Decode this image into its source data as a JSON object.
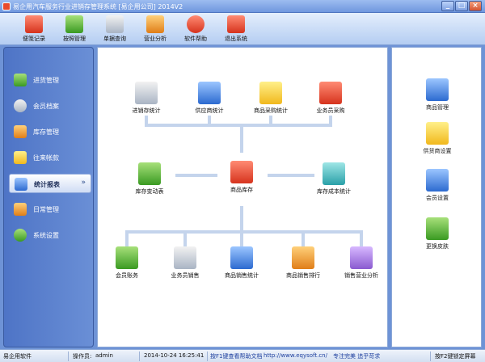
{
  "window": {
    "title": "易企用汽车服务行业进销存管理系统 [易企用公司] 2014V2",
    "controls": {
      "minimize": "_",
      "maximize": "□",
      "close": "×"
    }
  },
  "toolbar": {
    "items": [
      {
        "label": "便笺记录",
        "icon": "notepad-icon"
      },
      {
        "label": "按照管理",
        "icon": "users-icon"
      },
      {
        "label": "单据查询",
        "icon": "magnifier-icon"
      },
      {
        "label": "营业分析",
        "icon": "bar-chart-icon"
      },
      {
        "label": "软件帮助",
        "icon": "help-icon"
      },
      {
        "label": "退出系统",
        "icon": "power-icon"
      }
    ]
  },
  "sidebar": {
    "items": [
      {
        "label": "进货管理",
        "icon": "plus-icon"
      },
      {
        "label": "会员档案",
        "icon": "members-icon"
      },
      {
        "label": "库存管理",
        "icon": "star-icon"
      },
      {
        "label": "往来帐款",
        "icon": "dollar-icon"
      },
      {
        "label": "统计报表",
        "icon": "stats-icon",
        "active": true,
        "chevron": "»"
      },
      {
        "label": "日常管理",
        "icon": "folder-icon"
      },
      {
        "label": "系统设置",
        "icon": "gear-icon"
      }
    ]
  },
  "main": {
    "top_nodes": [
      {
        "label": "进销存统计",
        "icon": "report-chart-icon"
      },
      {
        "label": "供应商统计",
        "icon": "supplier-book-icon"
      },
      {
        "label": "商品采购统计",
        "icon": "purchase-chart-icon"
      },
      {
        "label": "业务员采购",
        "icon": "salesman-icon"
      }
    ],
    "middle_nodes": [
      {
        "label": "库存变动表",
        "icon": "boxes-icon"
      },
      {
        "label": "商品库存",
        "icon": "house-icon"
      },
      {
        "label": "库存成本统计",
        "icon": "cost-chart-icon"
      }
    ],
    "bottom_nodes": [
      {
        "label": "会员账务",
        "icon": "member-account-icon"
      },
      {
        "label": "业务员销售",
        "icon": "salesman-sales-icon"
      },
      {
        "label": "商品销售统计",
        "icon": "sales-stat-icon"
      },
      {
        "label": "商品销售排行",
        "icon": "sales-rank-icon"
      },
      {
        "label": "销售营业分析",
        "icon": "sales-analysis-icon"
      }
    ]
  },
  "rightpanel": {
    "items": [
      {
        "label": "商品管理",
        "icon": "product-manage-icon"
      },
      {
        "label": "供货商设置",
        "icon": "supplier-settings-icon"
      },
      {
        "label": "会员设置",
        "icon": "member-settings-icon"
      },
      {
        "label": "更换皮肤",
        "icon": "skin-icon"
      }
    ]
  },
  "statusbar": {
    "app": "易企用软件",
    "operator_label": "操作员:",
    "operator": "admin",
    "datetime": "2014-10-24 16:25:41",
    "help": "按F1键查看帮助文档",
    "url": "http://www.eqysoft.cn/",
    "slogan": "专注完美 追乎苛求",
    "lock": "按F2键锁定屏幕"
  }
}
